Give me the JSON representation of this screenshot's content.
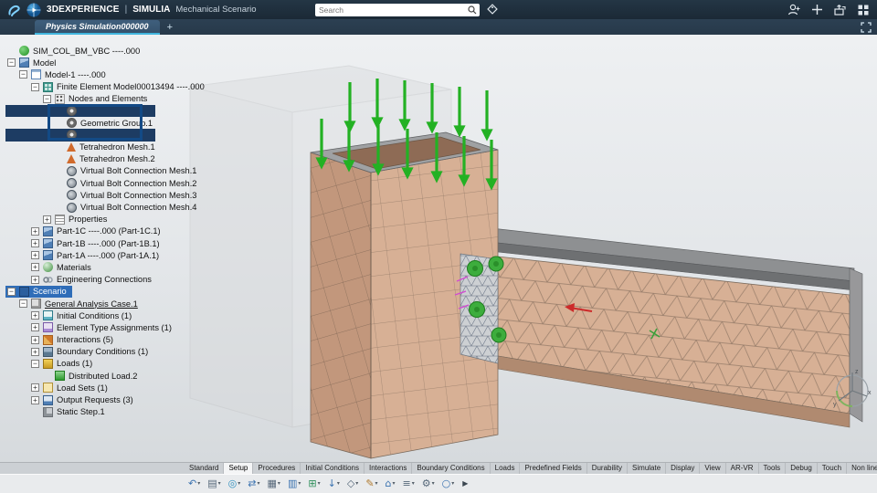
{
  "titlebar": {
    "brand": "3DEXPERIENCE",
    "divider": "|",
    "app": "SIMULIA",
    "module": "Mechanical Scenario",
    "search": {
      "placeholder": "Search"
    }
  },
  "tabbar": {
    "active_tab": "Physics Simulation000000",
    "add_label": "+"
  },
  "tree": {
    "items": [
      {
        "level": 0,
        "label": "SIM_COL_BM_VBC ----.000",
        "icon": "product"
      },
      {
        "level": 0,
        "label": "Model",
        "icon": "model",
        "expand": "minus"
      },
      {
        "level": 1,
        "label": "Model-1 ----.000",
        "icon": "doc",
        "expand": "minus"
      },
      {
        "level": 2,
        "label": "Finite Element Model00013494 ----.000",
        "icon": "fem",
        "expand": "minus"
      },
      {
        "level": 3,
        "label": "Nodes and Elements",
        "icon": "nodes",
        "expand": "minus"
      },
      {
        "level": 4,
        "label": "",
        "icon": "group",
        "selected": true
      },
      {
        "level": 4,
        "label": "Geometric Group.1",
        "icon": "group"
      },
      {
        "level": 4,
        "label": "",
        "icon": "group",
        "selected": true
      },
      {
        "level": 4,
        "label": "Tetrahedron Mesh.1",
        "icon": "tetra"
      },
      {
        "level": 4,
        "label": "Tetrahedron Mesh.2",
        "icon": "tetra"
      },
      {
        "level": 4,
        "label": "Virtual Bolt Connection Mesh.1",
        "icon": "bolt"
      },
      {
        "level": 4,
        "label": "Virtual Bolt Connection Mesh.2",
        "icon": "bolt"
      },
      {
        "level": 4,
        "label": "Virtual Bolt Connection Mesh.3",
        "icon": "bolt"
      },
      {
        "level": 4,
        "label": "Virtual Bolt Connection Mesh.4",
        "icon": "bolt"
      },
      {
        "level": 3,
        "label": "Properties",
        "icon": "props",
        "expand": "plus"
      },
      {
        "level": 2,
        "label": "Part-1C ----.000 (Part-1C.1)",
        "icon": "part",
        "expand": "plus"
      },
      {
        "level": 2,
        "label": "Part-1B ----.000 (Part-1B.1)",
        "icon": "part",
        "expand": "plus"
      },
      {
        "level": 2,
        "label": "Part-1A ----.000 (Part-1A.1)",
        "icon": "part",
        "expand": "plus"
      },
      {
        "level": 2,
        "label": "Materials",
        "icon": "material",
        "expand": "plus"
      },
      {
        "level": 2,
        "label": "Engineering Connections",
        "icon": "connect",
        "expand": "plus"
      },
      {
        "level": 0,
        "label": "Scenario",
        "icon": "scenario",
        "expand": "minus",
        "highlight": "blue"
      },
      {
        "level": 1,
        "label": "General Analysis Case.1",
        "icon": "case",
        "expand": "minus",
        "underline": true
      },
      {
        "level": 2,
        "label": "Initial Conditions (1)",
        "icon": "init",
        "expand": "plus"
      },
      {
        "level": 2,
        "label": "Element Type Assignments (1)",
        "icon": "eta",
        "expand": "plus"
      },
      {
        "level": 2,
        "label": "Interactions (5)",
        "icon": "inter",
        "expand": "plus"
      },
      {
        "level": 2,
        "label": "Boundary Conditions (1)",
        "icon": "bc",
        "expand": "plus"
      },
      {
        "level": 2,
        "label": "Loads (1)",
        "icon": "load",
        "expand": "minus"
      },
      {
        "level": 3,
        "label": "Distributed Load.2",
        "icon": "dload"
      },
      {
        "level": 2,
        "label": "Load Sets (1)",
        "icon": "lset",
        "expand": "plus"
      },
      {
        "level": 2,
        "label": "Output Requests (3)",
        "icon": "out",
        "expand": "plus"
      },
      {
        "level": 2,
        "label": "Static Step.1",
        "icon": "step"
      }
    ]
  },
  "viewport": {
    "compass": {
      "x": "x",
      "y": "y",
      "z": "z"
    }
  },
  "ribbon": {
    "tabs": [
      {
        "label": "Standard"
      },
      {
        "label": "Setup",
        "active": true
      },
      {
        "label": "Procedures"
      },
      {
        "label": "Initial Conditions"
      },
      {
        "label": "Interactions"
      },
      {
        "label": "Boundary Conditions"
      },
      {
        "label": "Loads"
      },
      {
        "label": "Predefined Fields"
      },
      {
        "label": "Durability"
      },
      {
        "label": "Simulate"
      },
      {
        "label": "Display"
      },
      {
        "label": "View"
      },
      {
        "label": "AR-VR"
      },
      {
        "label": "Tools"
      },
      {
        "label": "Debug"
      },
      {
        "label": "Touch"
      },
      {
        "label": "Non linear versioning"
      }
    ],
    "icons": [
      {
        "name": "undo-icon",
        "glyph": "↶",
        "color": "#3a72b0"
      },
      {
        "name": "clipboard-icon",
        "glyph": "▤",
        "color": "#56687a"
      },
      {
        "name": "web-icon",
        "glyph": "◎",
        "color": "#2f8fbe"
      },
      {
        "name": "transfer-icon",
        "glyph": "⇄",
        "color": "#3a72b0"
      },
      {
        "name": "table-icon",
        "glyph": "▦",
        "color": "#56687a"
      },
      {
        "name": "panel-icon",
        "glyph": "▥",
        "color": "#3a72b0"
      },
      {
        "name": "grid-icon",
        "glyph": "⊞",
        "color": "#2e8f5b"
      },
      {
        "name": "import-icon",
        "glyph": "↓",
        "color": "#3a72b0"
      },
      {
        "name": "measure-icon",
        "glyph": "◇",
        "color": "#56687a"
      },
      {
        "name": "edit-icon",
        "glyph": "✎",
        "color": "#b07a2e"
      },
      {
        "name": "home-icon",
        "glyph": "⌂",
        "color": "#3a72b0"
      },
      {
        "name": "list-icon",
        "glyph": "≡",
        "color": "#56687a"
      },
      {
        "name": "settings-icon",
        "glyph": "⚙",
        "color": "#56687a"
      },
      {
        "name": "probe-icon",
        "glyph": "○",
        "color": "#3a72b0"
      }
    ],
    "overflow": "▶"
  }
}
